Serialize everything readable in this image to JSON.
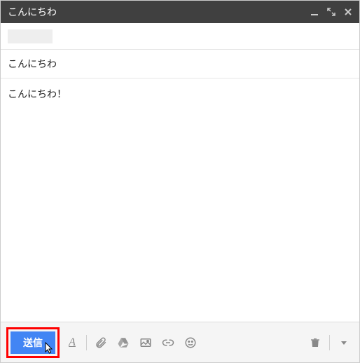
{
  "header": {
    "title": "こんにちわ"
  },
  "compose": {
    "subject": "こんにちわ",
    "body": "こんにちわ！"
  },
  "toolbar": {
    "send_label": "送信",
    "format_a": "A"
  },
  "icons": {
    "minimize": "minimize",
    "expand": "expand",
    "close": "close",
    "attach": "attach",
    "drive": "drive",
    "image": "image",
    "link": "link",
    "emoji": "emoji",
    "trash": "trash",
    "more": "more"
  },
  "colors": {
    "header_bg": "#404040",
    "send_bg": "#4285f4",
    "highlight": "#ff0000",
    "toolbar_bg": "#f5f5f5",
    "icon": "#888888"
  }
}
